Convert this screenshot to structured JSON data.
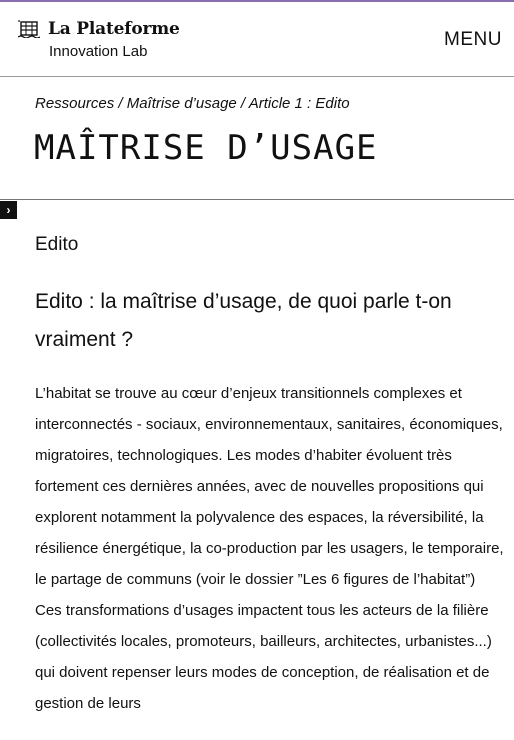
{
  "header": {
    "logo_title": "La Plateforme",
    "logo_subtitle": "Innovation Lab",
    "logo_icon": "building-icon",
    "menu_label": "MENU"
  },
  "breadcrumb": "Ressources / Maîtrise d’usage / Article 1 : Edito",
  "page_title": "MAÎTRISE D’USAGE",
  "sidebar_toggle": {
    "icon": "chevron-right-icon",
    "glyph": "›"
  },
  "article": {
    "section_title": "Edito",
    "heading": "Edito : la maîtrise d’usage, de quoi parle t-on vraiment ?",
    "body": "L’habitat se trouve au cœur d’enjeux transitionnels complexes et interconnectés  - sociaux, environnementaux, sanitaires, économiques, migratoires, technologiques. Les modes d’habiter évoluent très fortement ces dernières années, avec de nouvelles propositions qui explorent notamment la polyvalence des espaces, la réversibilité, la résilience énergétique, la co-production par les usagers, le temporaire, le partage de communs (voir le dossier ”Les 6 figures de l’habitat”)  Ces transformations d’usages impactent tous les acteurs de la filière (collectivités locales, promoteurs, bailleurs, architectes, urbanistes...) qui doivent repenser leurs modes de conception, de réalisation et de gestion de leurs"
  },
  "colors": {
    "accent": "#8a6fb0",
    "text": "#111111",
    "divider": "#9a9a9a"
  }
}
